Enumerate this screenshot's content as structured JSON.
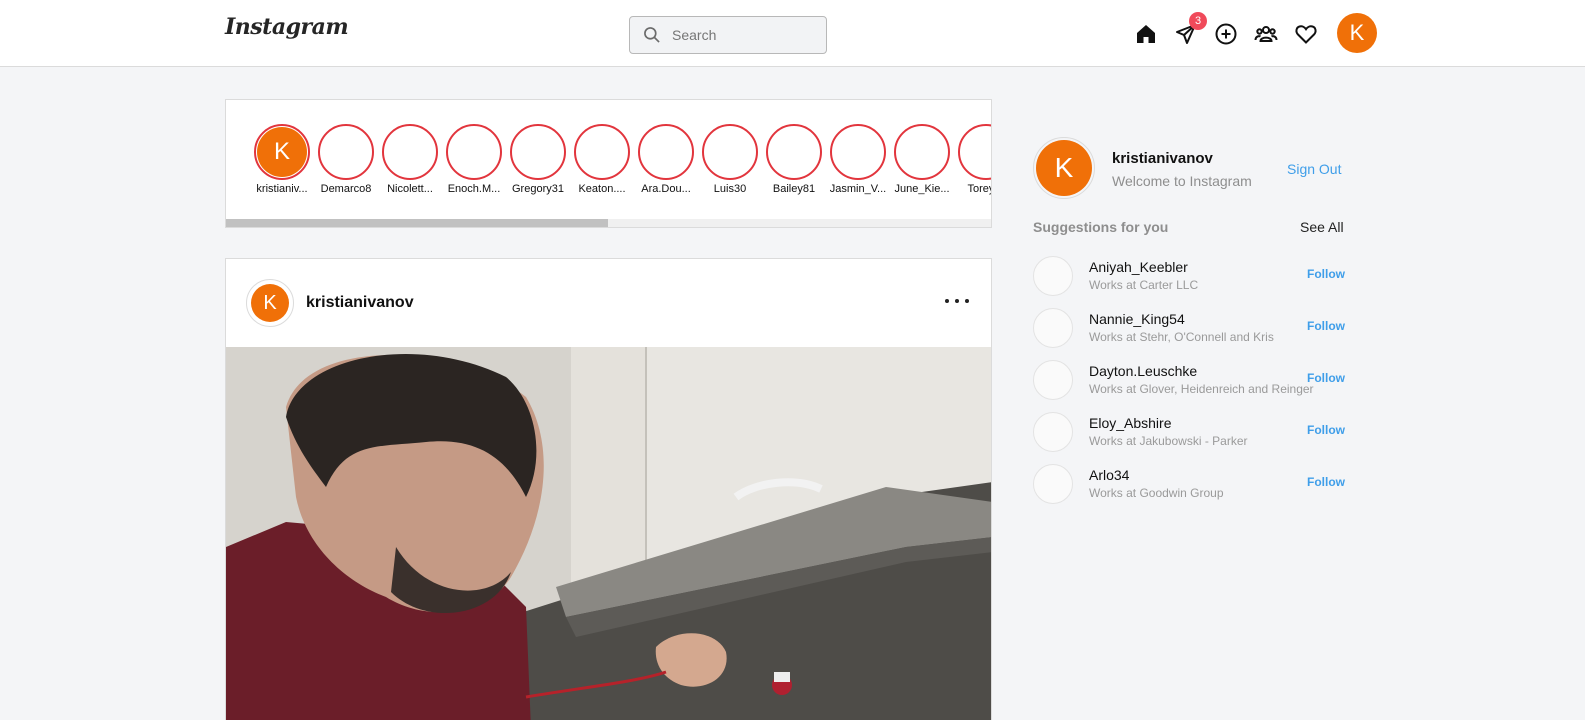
{
  "header": {
    "logo": "Instagram",
    "search_placeholder": "Search",
    "messages_badge": "3",
    "icons": [
      "home-icon",
      "direct-message-icon",
      "new-post-icon",
      "people-icon",
      "heart-icon"
    ],
    "avatar_letter": "K"
  },
  "stories": [
    {
      "name": "kristianiv...",
      "letter": "K",
      "is_me": true
    },
    {
      "name": "Demarco8"
    },
    {
      "name": "Nicolett..."
    },
    {
      "name": "Enoch.M..."
    },
    {
      "name": "Gregory31"
    },
    {
      "name": "Keaton...."
    },
    {
      "name": "Ara.Dou..."
    },
    {
      "name": "Luis30"
    },
    {
      "name": "Bailey81"
    },
    {
      "name": "Jasmin_V..."
    },
    {
      "name": "June_Kie..."
    },
    {
      "name": "Torey.R"
    }
  ],
  "post": {
    "username": "kristianivanov",
    "avatar_letter": "K"
  },
  "sidebar": {
    "username": "kristianivanov",
    "subtitle": "Welcome to Instagram",
    "avatar_letter": "K",
    "sign_out": "Sign Out",
    "suggestions_title": "Suggestions for you",
    "see_all": "See All",
    "follow_label": "Follow",
    "suggestions": [
      {
        "name": "Aniyah_Keebler",
        "sub": "Works at Carter LLC"
      },
      {
        "name": "Nannie_King54",
        "sub": "Works at Stehr, O'Connell and Kris"
      },
      {
        "name": "Dayton.Leuschke",
        "sub": "Works at Glover, Heidenreich and Reinger"
      },
      {
        "name": "Eloy_Abshire",
        "sub": "Works at Jakubowski - Parker"
      },
      {
        "name": "Arlo34",
        "sub": "Works at Goodwin Group"
      }
    ]
  },
  "colors": {
    "accent": "#3f9ee9",
    "avatar": "#f07008",
    "story_ring": "#e2353d",
    "badge": "#f04a5a"
  }
}
